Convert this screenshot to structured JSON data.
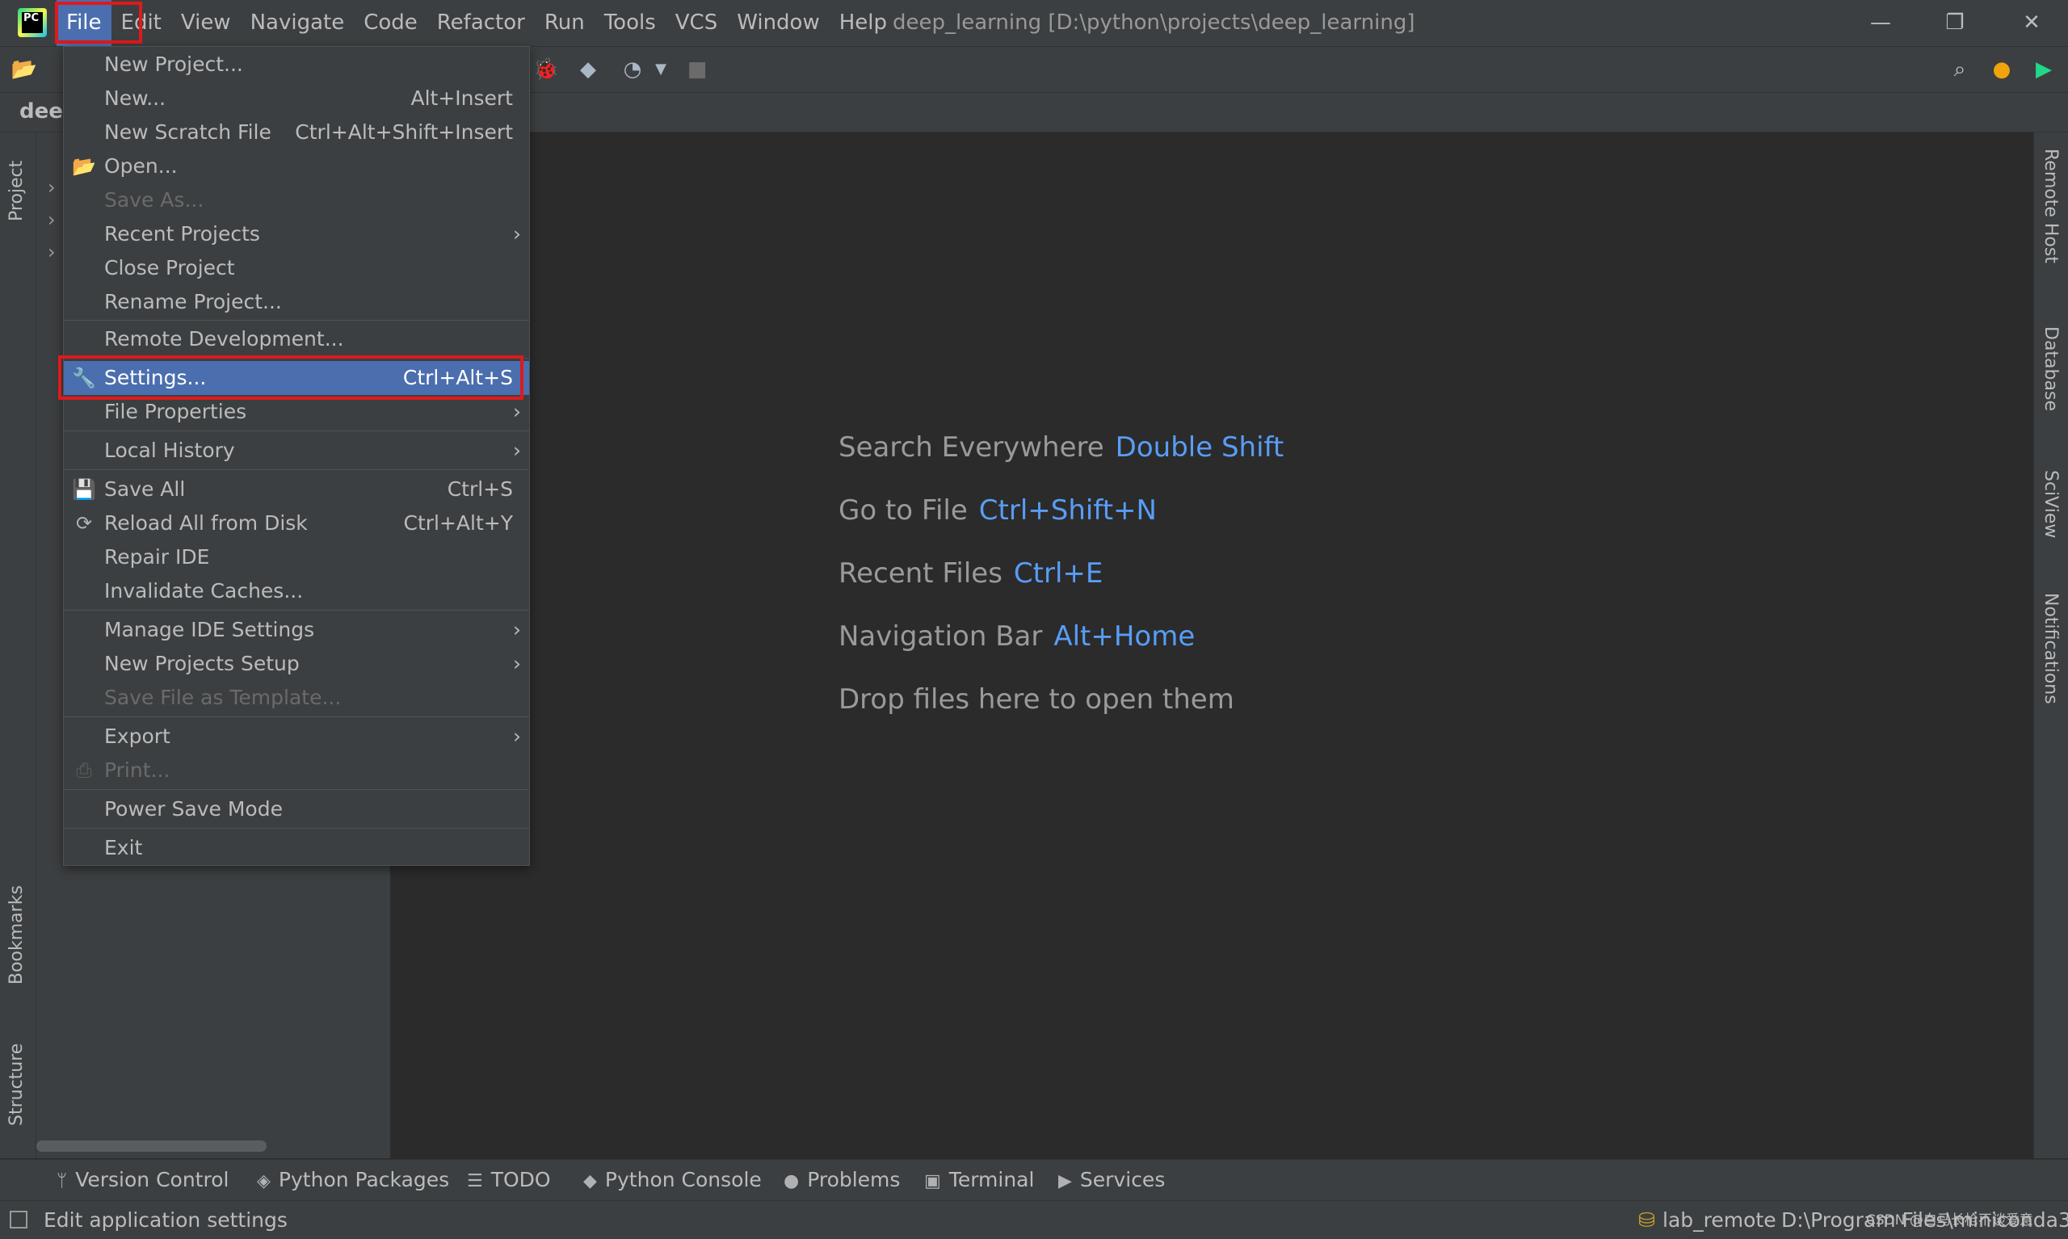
{
  "window": {
    "title": "deep_learning [D:\\python\\projects\\deep_learning]",
    "minimize": "—",
    "maximize": "❐",
    "close": "✕"
  },
  "menubar": [
    "File",
    "Edit",
    "View",
    "Navigate",
    "Code",
    "Refactor",
    "Run",
    "Tools",
    "VCS",
    "Window",
    "Help"
  ],
  "nav": {
    "crumb": "deep"
  },
  "file_menu": {
    "new_project": "New Project...",
    "new": "New...",
    "new_shortcut": "Alt+Insert",
    "new_scratch": "New Scratch File",
    "new_scratch_shortcut": "Ctrl+Alt+Shift+Insert",
    "open": "Open...",
    "save_as": "Save As...",
    "recent_projects": "Recent Projects",
    "close_project": "Close Project",
    "rename_project": "Rename Project...",
    "remote_dev": "Remote Development...",
    "settings": "Settings...",
    "settings_shortcut": "Ctrl+Alt+S",
    "file_properties": "File Properties",
    "local_history": "Local History",
    "save_all": "Save All",
    "save_all_shortcut": "Ctrl+S",
    "reload": "Reload All from Disk",
    "reload_shortcut": "Ctrl+Alt+Y",
    "repair_ide": "Repair IDE",
    "invalidate": "Invalidate Caches...",
    "manage_ide": "Manage IDE Settings",
    "new_projects_setup": "New Projects Setup",
    "save_template": "Save File as Template...",
    "export": "Export",
    "print": "Print...",
    "power_save": "Power Save Mode",
    "exit": "Exit"
  },
  "editor_hints": [
    {
      "label": "Search Everywhere",
      "key": "Double Shift"
    },
    {
      "label": "Go to File",
      "key": "Ctrl+Shift+N"
    },
    {
      "label": "Recent Files",
      "key": "Ctrl+E"
    },
    {
      "label": "Navigation Bar",
      "key": "Alt+Home"
    },
    {
      "label": "Drop files here to open them",
      "key": ""
    }
  ],
  "left_tabs": {
    "project": "Project",
    "bookmarks": "Bookmarks",
    "structure": "Structure"
  },
  "right_tabs": {
    "remote_host": "Remote Host",
    "database": "Database",
    "sciview": "SciView",
    "notifications": "Notifications"
  },
  "bottom_tools": [
    "Version Control",
    "Python Packages",
    "TODO",
    "Python Console",
    "Problems",
    "Terminal",
    "Services"
  ],
  "status": {
    "message": "Edit application settings",
    "interpreter": "lab_remote",
    "path": "D:\\Program Files\\miniconda3",
    "watermark": "CSDN @白马长枪不谈爱意"
  },
  "colors": {
    "selection": "#4b6eaf",
    "highlight_box": "#e0191c",
    "key_hint": "#589df6"
  }
}
